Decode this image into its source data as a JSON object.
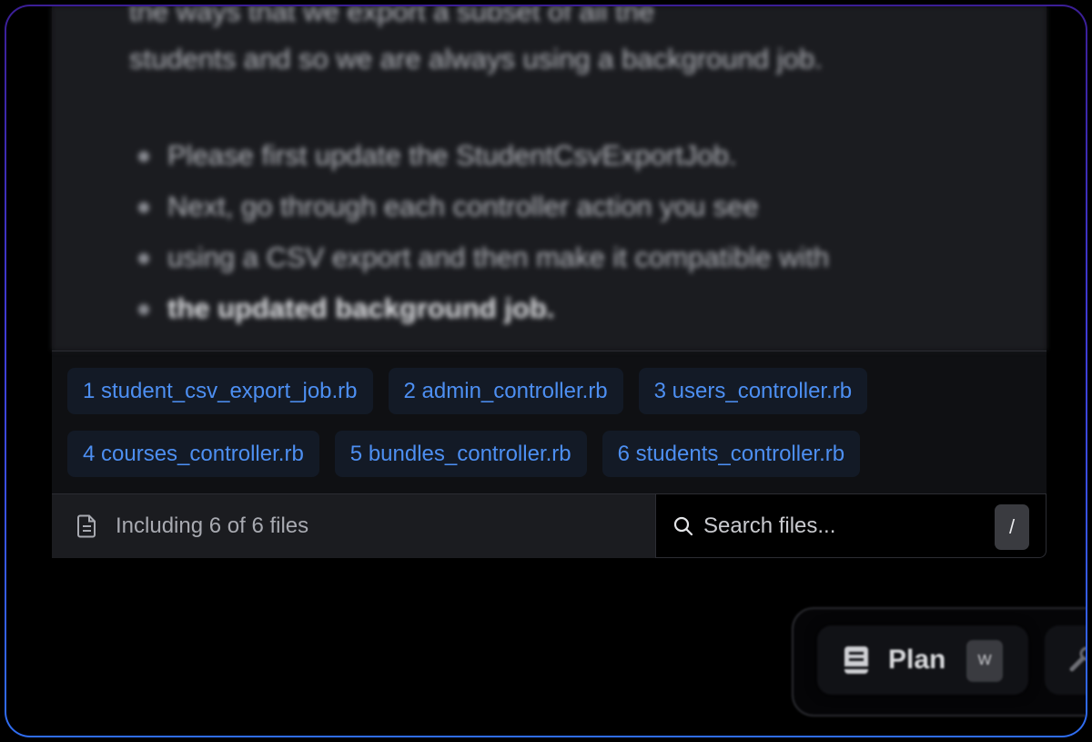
{
  "message": {
    "line1": "the ways that we export a subset of all the",
    "line2": "students and so we are always using a background job.",
    "bullets": [
      "Please first update the StudentCsvExportJob.",
      "Next, go through each controller action you see",
      "using a CSV export and then make it compatible with",
      "the updated background job."
    ]
  },
  "files": {
    "row1": [
      "1 student_csv_export_job.rb",
      "2 admin_controller.rb",
      "3 users_controller.rb"
    ],
    "row2": [
      "4 courses_controller.rb",
      "5 bundles_controller.rb",
      "6 students_controller.rb"
    ]
  },
  "footer": {
    "including_text": "Including 6 of 6 files",
    "search_placeholder": "Search files...",
    "search_shortcut": "/"
  },
  "mode": {
    "plan_label": "Plan",
    "plan_shortcut": "W"
  },
  "colors": {
    "chip_text": "#4d8ff2",
    "chip_bg": "#131a26",
    "frame_gradient_top": "#3b1e96",
    "frame_gradient_bottom": "#2f6df0"
  }
}
